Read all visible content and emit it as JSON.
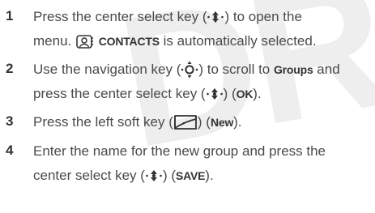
{
  "watermark": "DR",
  "steps": [
    {
      "number": "1",
      "a": "Press the center select key (",
      "b": ") to open the",
      "c": "menu. ",
      "d": "CONTACTS",
      "e": " is automatically selected."
    },
    {
      "number": "2",
      "a": "Use the navigation key (",
      "b": ") to scroll to ",
      "c": "Groups",
      "d": " and",
      "e": "press the center select key (",
      "f": ") (",
      "g": "OK",
      "h": ")."
    },
    {
      "number": "3",
      "a": "Press the left soft key (",
      "b": ") (",
      "c": "New",
      "d": ")."
    },
    {
      "number": "4",
      "a": "Enter the name for the new group and press the",
      "b": "center select key (",
      "c": ") (",
      "d": "SAVE",
      "e": ")."
    }
  ],
  "icons": {
    "center_select": "center-select-key-icon",
    "navigation": "navigation-key-icon",
    "contacts": "contacts-icon",
    "left_soft_key": "left-soft-key-icon"
  }
}
